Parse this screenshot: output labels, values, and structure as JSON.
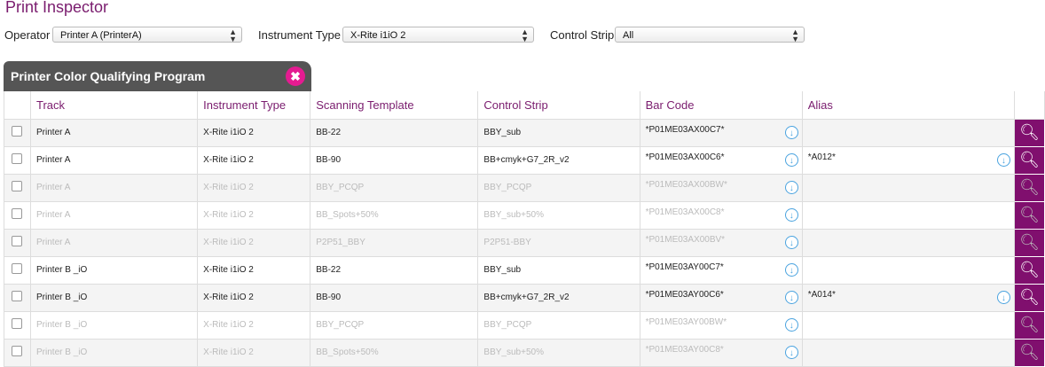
{
  "page": {
    "title": "Print Inspector"
  },
  "filters": {
    "operator_label": "Operator",
    "operator_value": "Printer A (PrinterA)",
    "instrument_label": "Instrument Type",
    "instrument_value": "X-Rite i1iO 2",
    "strip_label": "Control Strip",
    "strip_value": "All"
  },
  "panel": {
    "title": "Printer Color Qualifying Program",
    "tools_icon": "wrench-hammer-icon"
  },
  "columns": [
    "",
    "Track",
    "Instrument Type",
    "Scanning Template",
    "Control Strip",
    "Bar Code",
    "Alias",
    ""
  ],
  "rows": [
    {
      "track": "Printer A",
      "instrument": "X-Rite i1iO 2",
      "template": "BB-22",
      "strip": "BBY_sub",
      "barcode": "*P01ME03AX00C7*",
      "alias": ""
    },
    {
      "track": "Printer A",
      "instrument": "X-Rite i1iO 2",
      "template": "BB-90",
      "strip": "BB+cmyk+G7_2R_v2",
      "barcode": "*P01ME03AX00C6*",
      "alias": "*A012*"
    },
    {
      "track": "Printer A",
      "instrument": "X-Rite i1iO 2",
      "template": "BBY_PCQP",
      "strip": "BBY_PCQP",
      "barcode": "*P01ME03AX00BW*",
      "alias": ""
    },
    {
      "track": "Printer A",
      "instrument": "X-Rite i1iO 2",
      "template": "BB_Spots+50%",
      "strip": "BBY_sub+50%",
      "barcode": "*P01ME03AX00C8*",
      "alias": ""
    },
    {
      "track": "Printer A",
      "instrument": "X-Rite i1iO 2",
      "template": "P2P51_BBY",
      "strip": "P2P51-BBY",
      "barcode": "*P01ME03AX00BV*",
      "alias": ""
    },
    {
      "track": "Printer B _iO",
      "instrument": "X-Rite i1iO 2",
      "template": "BB-22",
      "strip": "BBY_sub",
      "barcode": "*P01ME03AY00C7*",
      "alias": ""
    },
    {
      "track": "Printer B _iO",
      "instrument": "X-Rite i1iO 2",
      "template": "BB-90",
      "strip": "BB+cmyk+G7_2R_v2",
      "barcode": "*P01ME03AY00C6*",
      "alias": "*A014*"
    },
    {
      "track": "Printer B _iO",
      "instrument": "X-Rite i1iO 2",
      "template": "BBY_PCQP",
      "strip": "BBY_PCQP",
      "barcode": "*P01ME03AY00BW*",
      "alias": ""
    },
    {
      "track": "Printer B _iO",
      "instrument": "X-Rite i1iO 2",
      "template": "BB_Spots+50%",
      "strip": "BBY_sub+50%",
      "barcode": "*P01ME03AY00C8*",
      "alias": ""
    }
  ],
  "colors": {
    "title": "#7a1c6e",
    "header": "#555555",
    "accent": "#e41b91",
    "action": "#800f6e",
    "link": "#4aa3df"
  }
}
